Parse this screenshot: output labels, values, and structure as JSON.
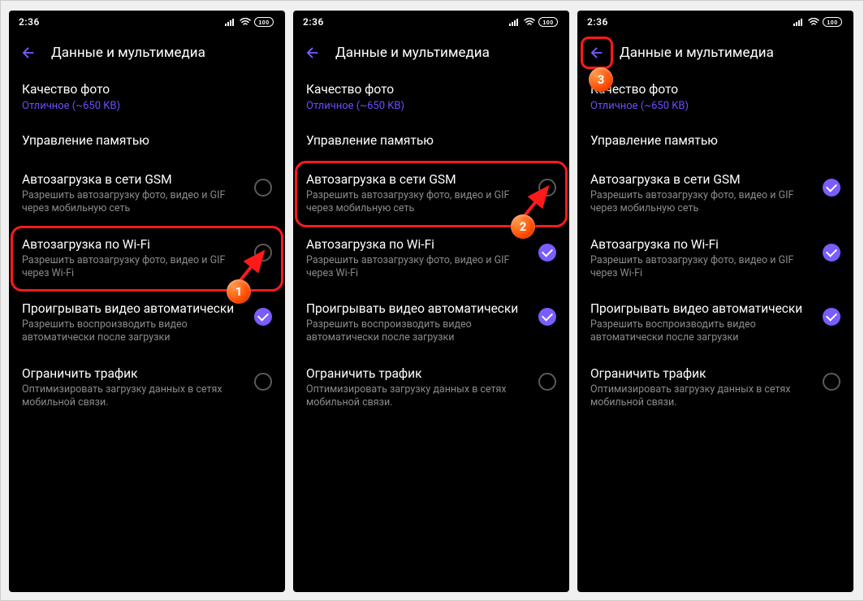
{
  "status": {
    "time": "2:36",
    "battery": "100"
  },
  "header": {
    "title": "Данные и мультимедиа"
  },
  "photoQuality": {
    "title": "Качество фото",
    "value": "Отличное (~650 KB)"
  },
  "memory": {
    "title": "Управление памятью"
  },
  "items": {
    "gsm": {
      "title": "Автозагрузка в сети GSM",
      "desc": "Разрешить автозагрузку фото, видео и GIF через мобильную сеть"
    },
    "wifi": {
      "title": "Автозагрузка по Wi-Fi",
      "desc": "Разрешить автозагрузку фото, видео и GIF через Wi-Fi"
    },
    "autoplay": {
      "title": "Проигрывать видео автоматически",
      "desc": "Разрешить воспроизводить видео автоматически после загрузки"
    },
    "limit": {
      "title": "Ограничить трафик",
      "desc": "Оптимизировать загрузку данных в сетях мобильной связи."
    }
  },
  "screens": [
    {
      "gsm": false,
      "wifi": false,
      "autoplay": true,
      "limit": false,
      "highlight": "wifi",
      "step": "1",
      "arrow_to": "wifi_check",
      "badge_back": false
    },
    {
      "gsm": false,
      "wifi": true,
      "autoplay": true,
      "limit": false,
      "highlight": "gsm",
      "step": "2",
      "arrow_to": "gsm_check",
      "badge_back": false
    },
    {
      "gsm": true,
      "wifi": true,
      "autoplay": true,
      "limit": false,
      "highlight": "back",
      "step": "3",
      "arrow_to": null,
      "badge_back": true
    }
  ]
}
